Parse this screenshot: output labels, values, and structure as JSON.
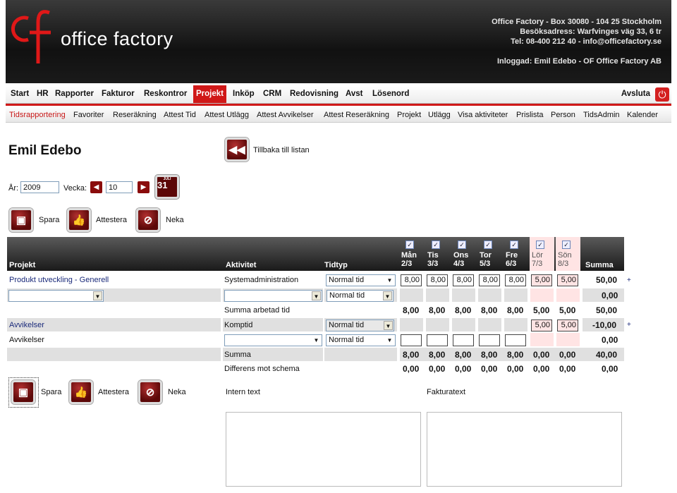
{
  "company": {
    "logo_text": "office factory",
    "address_line1": "Office Factory - Box 30080 - 104 25 Stockholm",
    "address_line2": "Besöksadress: Warfvinges väg 33, 6 tr",
    "address_line3": "Tel: 08-400 212 40 - info@officefactory.se",
    "logged_in": "Inloggad: Emil Edebo - OF Office Factory AB"
  },
  "main_nav": {
    "items": [
      "Start",
      "HR",
      "Rapporter",
      "Fakturor",
      "Reskontror",
      "Projekt",
      "Inköp",
      "CRM",
      "Redovisning",
      "Avst",
      "Lösenord"
    ],
    "active": "Projekt",
    "logout": "Avsluta",
    "accent": "#d01818"
  },
  "sub_nav": {
    "items": [
      "Tidsrapportering",
      "Favoriter",
      "Reseräkning",
      "Attest Tid",
      "Attest Utlägg",
      "Attest Avvikelser",
      "Attest Reseräkning",
      "Projekt",
      "Utlägg",
      "Visa aktiviteter",
      "Prislista",
      "Person",
      "TidsAdmin",
      "Kalender"
    ],
    "active": "Tidsrapportering"
  },
  "page": {
    "title": "Emil Edebo",
    "back_label": "Tillbaka till listan",
    "year_label": "År:",
    "year_value": "2009",
    "week_label": "Vecka:",
    "week_value": "10",
    "calendar_day": "31",
    "calendar_month": "JULI"
  },
  "actions": {
    "save": "Spara",
    "approve": "Attestera",
    "reject": "Neka"
  },
  "table": {
    "col_project": "Projekt",
    "col_activity": "Aktivitet",
    "col_timetype": "Tidtyp",
    "col_sum": "Summa",
    "checkbox_mark": "✓",
    "days": [
      {
        "name": "Mån",
        "date": "2/3",
        "weekend": false
      },
      {
        "name": "Tis",
        "date": "3/3",
        "weekend": false
      },
      {
        "name": "Ons",
        "date": "4/3",
        "weekend": false
      },
      {
        "name": "Tor",
        "date": "5/3",
        "weekend": false
      },
      {
        "name": "Fre",
        "date": "6/3",
        "weekend": false
      },
      {
        "name": "Lör",
        "date": "7/3",
        "weekend": true
      },
      {
        "name": "Sön",
        "date": "8/3",
        "weekend": true
      }
    ],
    "row1": {
      "project": "Produkt utveckling - Generell",
      "activity": "Systemadministration",
      "timetype": "Normal tid",
      "hours": [
        "8,00",
        "8,00",
        "8,00",
        "8,00",
        "8,00",
        "5,00",
        "5,00"
      ],
      "sum": "50,00",
      "plus": "+"
    },
    "row2": {
      "timetype": "Normal tid",
      "sum": "0,00"
    },
    "worked_sum": {
      "label": "Summa arbetad tid",
      "values": [
        "8,00",
        "8,00",
        "8,00",
        "8,00",
        "8,00",
        "5,00",
        "5,00"
      ],
      "sum": "50,00"
    },
    "deviation_row": {
      "project": "Avvikelser",
      "activity": "Komptid",
      "timetype": "Normal tid",
      "hours": [
        "5,00",
        "5,00"
      ],
      "sum": "-10,00",
      "plus": "+"
    },
    "deviation_row2": {
      "project": "Avvikelser",
      "timetype": "Normal tid",
      "sum": "0,00"
    },
    "total": {
      "label": "Summa",
      "values": [
        "8,00",
        "8,00",
        "8,00",
        "8,00",
        "8,00",
        "0,00",
        "0,00"
      ],
      "sum": "40,00"
    },
    "diff": {
      "label": "Differens mot schema",
      "values": [
        "0,00",
        "0,00",
        "0,00",
        "0,00",
        "0,00",
        "0,00",
        "0,00"
      ],
      "sum": "0,00"
    }
  },
  "notes": {
    "intern_label": "Intern text",
    "invoice_label": "Fakturatext"
  }
}
